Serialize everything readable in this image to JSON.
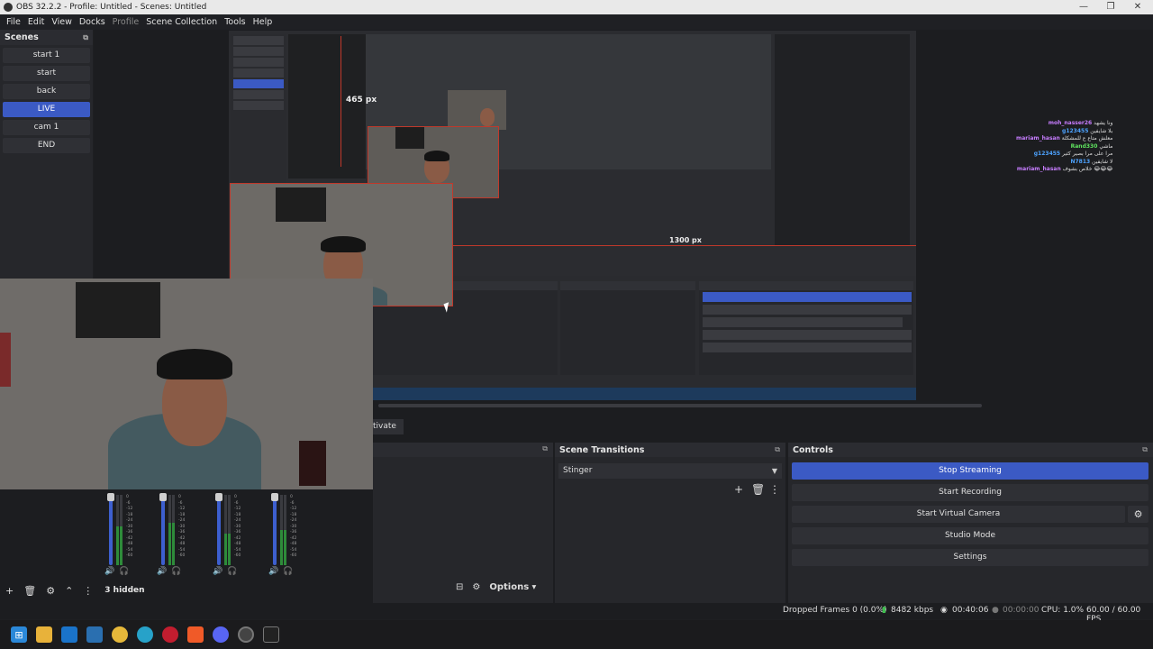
{
  "window": {
    "title": "OBS 32.2.2 - Profile: Untitled - Scenes: Untitled",
    "minimize": "—",
    "maximize": "❐",
    "close": "✕"
  },
  "menu": {
    "file": "File",
    "edit": "Edit",
    "view": "View",
    "docks": "Docks",
    "profile": "Profile",
    "scene_collection": "Scene Collection",
    "tools": "Tools",
    "help": "Help"
  },
  "scenes": {
    "title": "Scenes",
    "items": [
      {
        "label": "start 1",
        "active": false
      },
      {
        "label": "start",
        "active": false
      },
      {
        "label": "back",
        "active": false
      },
      {
        "label": "LIVE",
        "active": true
      },
      {
        "label": "cam 1",
        "active": false
      },
      {
        "label": "END",
        "active": false
      }
    ]
  },
  "preview": {
    "height_label": "465 px",
    "width_label": "1300 px",
    "chat_lines": [
      {
        "name": "moh_nasser26",
        "msg": "ونا يشهد",
        "color": "#c77dff"
      },
      {
        "name": "g123455",
        "msg": "بلا شايفين",
        "color": "#4da3ff"
      },
      {
        "name": "mariam_hasan",
        "msg": "معلش متاع ع للمشكلة",
        "color": "#c77dff"
      },
      {
        "name": "Rand330",
        "msg": "ماشي",
        "color": "#5fe35f"
      },
      {
        "name": "g123455",
        "msg": "مرا على مرا بصير كثير",
        "color": "#4da3ff"
      },
      {
        "name": "N7813",
        "msg": "لا شايفين",
        "color": "#4da3ff"
      },
      {
        "name": "mariam_hasan",
        "msg": "خلاص بشوف 😂😂😂",
        "color": "#c77dff"
      }
    ]
  },
  "activate_label": "tivate",
  "scene_transitions": {
    "title": "Scene Transitions",
    "selected": "Stinger"
  },
  "controls": {
    "title": "Controls",
    "stop_streaming": "Stop Streaming",
    "start_recording": "Start Recording",
    "start_virtual_camera": "Start Virtual Camera",
    "studio_mode": "Studio Mode",
    "settings": "Settings"
  },
  "mixer": {
    "scale": [
      "0",
      "-6",
      "-12",
      "-18",
      "-24",
      "-30",
      "-36",
      "-42",
      "-48",
      "-54",
      "-60"
    ],
    "channels": [
      {
        "level_fraction": 0.55
      },
      {
        "level_fraction": 0.6
      },
      {
        "level_fraction": 0.45
      },
      {
        "level_fraction": 0.5
      }
    ],
    "options": "Options"
  },
  "sources_toolbar": {
    "hidden_count": "3 hidden"
  },
  "status": {
    "dropped_frames": "Dropped Frames 0 (0.0%)",
    "bitrate": "8482 kbps",
    "stream_time": "00:40:06",
    "record_time": "00:00:00",
    "cpu": "CPU: 1.0%",
    "fps": "60.00 / 60.00 FPS"
  },
  "colors": {
    "accent": "#3b5ac4",
    "signal": "#3fbf4f"
  },
  "taskbar": {
    "icons": [
      "windows-start-icon",
      "file-explorer-icon",
      "outlook-icon",
      "app-icon",
      "chrome-icon",
      "edge-icon",
      "opera-gx-icon",
      "brave-icon",
      "discord-icon",
      "obs-icon",
      "epic-games-icon"
    ]
  }
}
